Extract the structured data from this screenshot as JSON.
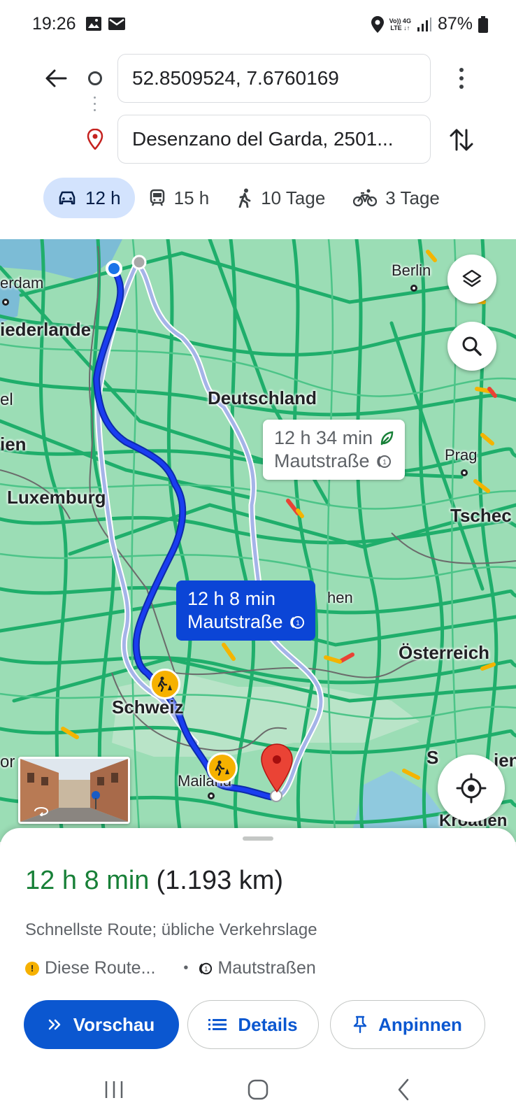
{
  "status_bar": {
    "time": "19:26",
    "network_top": "Vo)) 4G",
    "network_bottom": "LTE ↓↑",
    "battery": "87%"
  },
  "directions": {
    "origin": "52.8509524, 7.6760169",
    "destination": "Desenzano del Garda, 2501..."
  },
  "modes": [
    {
      "icon": "car-icon",
      "label": "12 h",
      "active": true
    },
    {
      "icon": "train-icon",
      "label": "15 h",
      "active": false
    },
    {
      "icon": "walking-icon",
      "label": "10 Tage",
      "active": false
    },
    {
      "icon": "bicycle-icon",
      "label": "3 Tage",
      "active": false
    }
  ],
  "map": {
    "labels": {
      "amsterdam": "erdam",
      "niederlande": "iederlande",
      "berlin": "Berlin",
      "deutschland": "Deutschland",
      "belgien_partial": "el",
      "belgien": "ien",
      "luxemburg": "Luxemburg",
      "prag": "Prag",
      "tschechien": "Tschec",
      "muenchen": "hen",
      "oesterreich": "Österreich",
      "schweiz": "Schweiz",
      "mailand": "Mailand",
      "slowenien": "S",
      "slowenien_end": "ien",
      "kroatien": "Kroatien",
      "frankreich_partial": "or"
    },
    "alt_route_card": {
      "line1": "12 h 34 min",
      "line2": "Mautstraße"
    },
    "main_route_card": {
      "line1": "12 h 8 min",
      "line2": "Mautstraße"
    },
    "colors": {
      "route_main": "#1a3df0",
      "route_alt": "#a5b4e8",
      "traffic": "#1fae6b",
      "map_bg": "#8bd6a8"
    }
  },
  "sheet": {
    "duration": "12 h 8 min",
    "distance": "(1.193 km)",
    "description": "Schnellste Route; übliche Verkehrslage",
    "warning": "Diese Route...",
    "bullet": "•",
    "tolls": "Mautstraßen",
    "buttons": {
      "preview": "Vorschau",
      "details": "Details",
      "pin": "Anpinnen"
    }
  }
}
